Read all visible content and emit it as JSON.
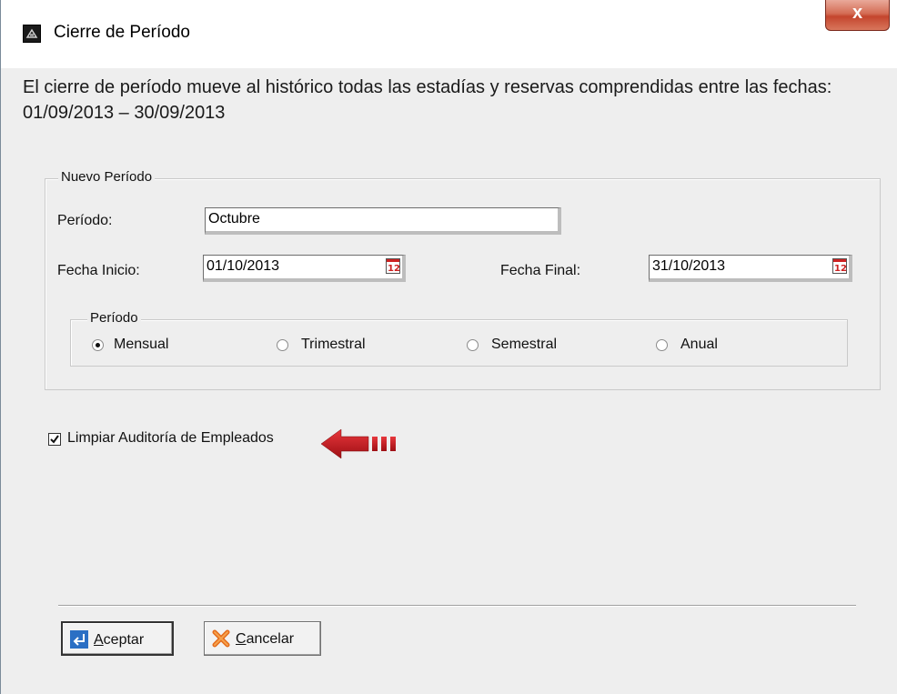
{
  "window": {
    "title": "Cierre de Período",
    "close_glyph": "x"
  },
  "description": "El cierre de período mueve al histórico todas las estadías y reservas comprendidas entre las fechas: 01/09/2013 – 30/09/2013",
  "nuevo_periodo": {
    "legend": "Nuevo Período",
    "periodo_label": "Período:",
    "periodo_value": "Octubre",
    "fecha_inicio_label": "Fecha Inicio:",
    "fecha_inicio_value": "01/10/2013",
    "fecha_final_label": "Fecha Final:",
    "fecha_final_value": "31/10/2013",
    "periodo_group": {
      "legend": "Período",
      "options": [
        {
          "label": "Mensual",
          "checked": true
        },
        {
          "label": "Trimestral",
          "checked": false
        },
        {
          "label": "Semestral",
          "checked": false
        },
        {
          "label": "Anual",
          "checked": false
        }
      ]
    }
  },
  "limpiar_auditoria": {
    "label": "Limpiar Auditoría de Empleados",
    "checked": true
  },
  "buttons": {
    "aceptar": {
      "accel": "A",
      "rest": "ceptar"
    },
    "cancelar": {
      "accel": "C",
      "rest": "ancelar"
    }
  },
  "icons": {
    "app": "app-icon",
    "calendar": "calendar-icon",
    "enter": "enter-icon",
    "cancel": "x-icon",
    "arrow": "red-arrow-icon"
  },
  "colors": {
    "close_button": "#c4452d",
    "arrow": "#c0161c",
    "enter_icon": "#2b6fc4",
    "cancel_icon": "#e46a1a"
  }
}
